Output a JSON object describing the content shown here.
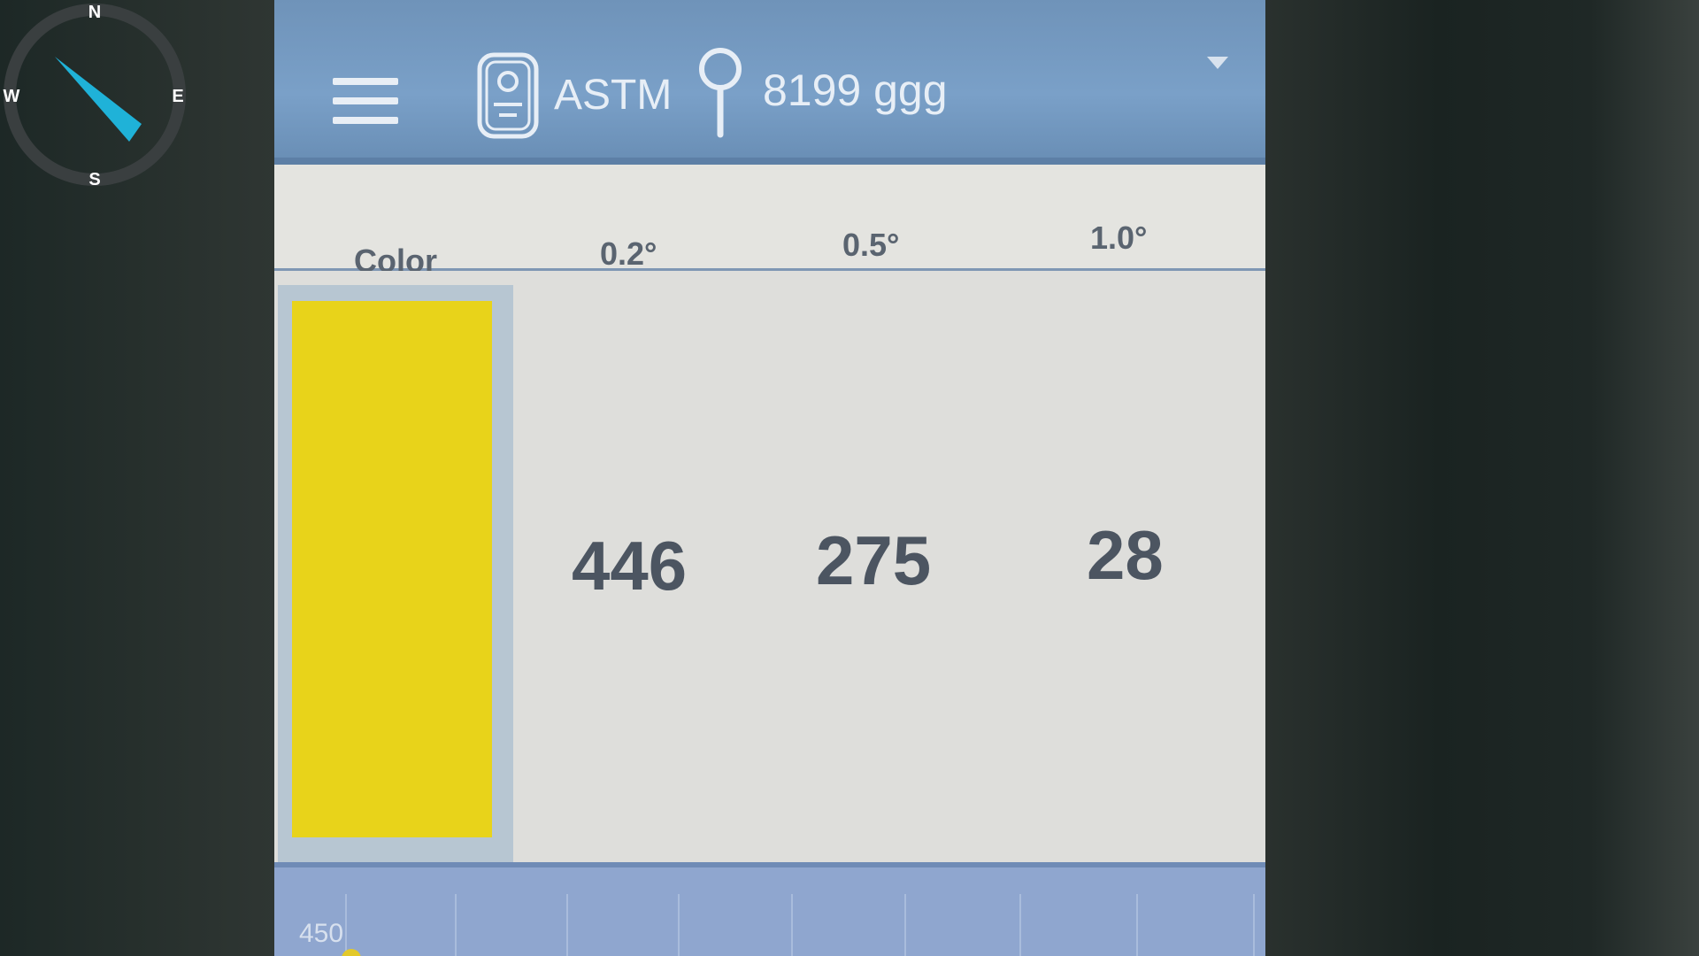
{
  "compass": {
    "north": "N",
    "south": "S",
    "east": "E",
    "west": "W",
    "needle_color": "#1fb2d8"
  },
  "header": {
    "standard": "ASTM",
    "location": "8199 ggg"
  },
  "table": {
    "columns": [
      "Color",
      "0.2°",
      "0.5°",
      "1.0°"
    ],
    "values": [
      "446",
      "275",
      "28"
    ],
    "swatch_color": "#e8d31a"
  },
  "chart": {
    "tick_label": "450"
  }
}
